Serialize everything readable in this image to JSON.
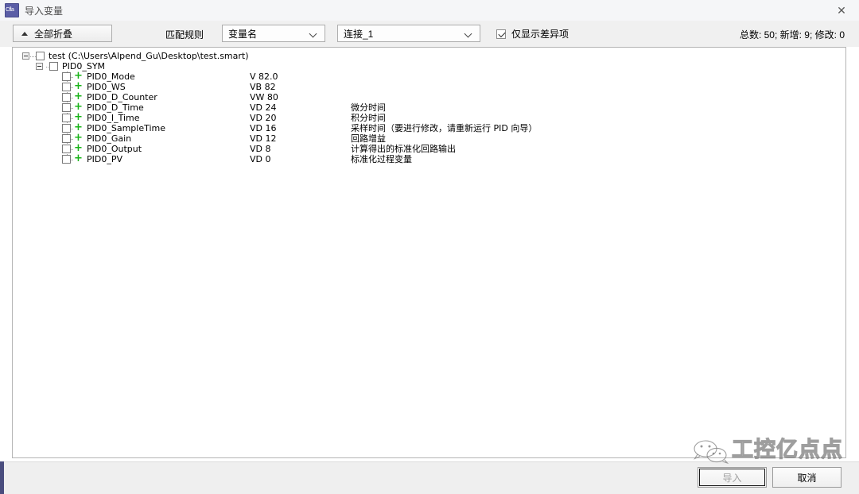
{
  "window": {
    "title": "导入变量",
    "app_icon": "app-icon",
    "close_icon": "✕"
  },
  "toolbar": {
    "collapse_all_label": "全部折叠",
    "collapse_icon": "triangle-up-icon",
    "match_rule_label": "匹配规则",
    "match_rule_value": "变量名",
    "connection_value": "连接_1",
    "diff_only_label": "仅显示差异项",
    "diff_only_checked": true,
    "counts_text": "总数: 50; 新增: 9; 修改: 0"
  },
  "tree": {
    "root": {
      "label": "test (C:\\Users\\Alpend_Gu\\Desktop\\test.smart)",
      "expanded": true,
      "checked": false
    },
    "group": {
      "label": "PID0_SYM",
      "expanded": true,
      "checked": false
    },
    "items": [
      {
        "name": "PID0_Mode",
        "address": "V 82.0",
        "comment": "",
        "status_icon": "plus-icon",
        "checked": false
      },
      {
        "name": "PID0_WS",
        "address": "VB 82",
        "comment": "",
        "status_icon": "plus-icon",
        "checked": false
      },
      {
        "name": "PID0_D_Counter",
        "address": "VW 80",
        "comment": "",
        "status_icon": "plus-icon",
        "checked": false
      },
      {
        "name": "PID0_D_Time",
        "address": "VD 24",
        "comment": "微分时间",
        "status_icon": "plus-icon",
        "checked": false
      },
      {
        "name": "PID0_I_Time",
        "address": "VD 20",
        "comment": "积分时间",
        "status_icon": "plus-icon",
        "checked": false
      },
      {
        "name": "PID0_SampleTime",
        "address": "VD 16",
        "comment": "采样时间（要进行修改，请重新运行 PID 向导）",
        "status_icon": "plus-icon",
        "checked": false
      },
      {
        "name": "PID0_Gain",
        "address": "VD 12",
        "comment": "回路增益",
        "status_icon": "plus-icon",
        "checked": false
      },
      {
        "name": "PID0_Output",
        "address": "VD 8",
        "comment": "计算得出的标准化回路输出",
        "status_icon": "plus-icon",
        "checked": false
      },
      {
        "name": "PID0_PV",
        "address": "VD 0",
        "comment": "标准化过程变量",
        "status_icon": "plus-icon",
        "checked": false
      }
    ]
  },
  "footer": {
    "import_label": "导入",
    "import_enabled": false,
    "cancel_label": "取消"
  },
  "watermark": {
    "text": "工控亿点点",
    "logo": "wechat-icon"
  },
  "colors": {
    "accent": "#19b319",
    "titlebar_bg": "#f5f6f8",
    "toolbar_bg": "#f0f0f0",
    "panel_bg": "#ffffff",
    "footer_bg": "#efefef",
    "left_strip": "#4a4d7e"
  }
}
